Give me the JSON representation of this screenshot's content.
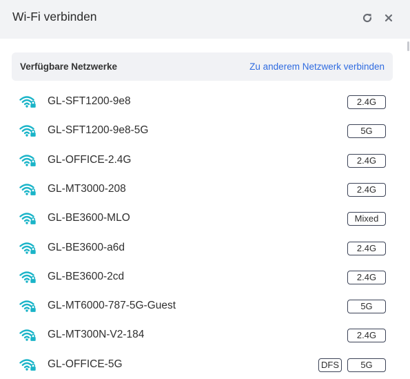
{
  "header": {
    "title": "Wi-Fi verbinden",
    "refresh_icon": "refresh-icon",
    "close_icon": "close-icon"
  },
  "list": {
    "heading": "Verfügbare Netzwerke",
    "join_other_link": "Zu anderem Netzwerk verbinden",
    "networks": [
      {
        "ssid": "GL-SFT1200-9e8",
        "band": "2.4G",
        "dfs": ""
      },
      {
        "ssid": "GL-SFT1200-9e8-5G",
        "band": "5G",
        "dfs": ""
      },
      {
        "ssid": "GL-OFFICE-2.4G",
        "band": "2.4G",
        "dfs": ""
      },
      {
        "ssid": "GL-MT3000-208",
        "band": "2.4G",
        "dfs": ""
      },
      {
        "ssid": "GL-BE3600-MLO",
        "band": "Mixed",
        "dfs": ""
      },
      {
        "ssid": "GL-BE3600-a6d",
        "band": "2.4G",
        "dfs": ""
      },
      {
        "ssid": "GL-BE3600-2cd",
        "band": "2.4G",
        "dfs": ""
      },
      {
        "ssid": "GL-MT6000-787-5G-Guest",
        "band": "5G",
        "dfs": ""
      },
      {
        "ssid": "GL-MT300N-V2-184",
        "band": "2.4G",
        "dfs": ""
      },
      {
        "ssid": "GL-OFFICE-5G",
        "band": "5G",
        "dfs": "DFS"
      }
    ]
  },
  "colors": {
    "accent": "#2f6be0",
    "wifi_icon": "#1ab4c8",
    "header_bg": "#f2f3f5"
  },
  "icons": {
    "network": "wifi-lock-icon"
  }
}
